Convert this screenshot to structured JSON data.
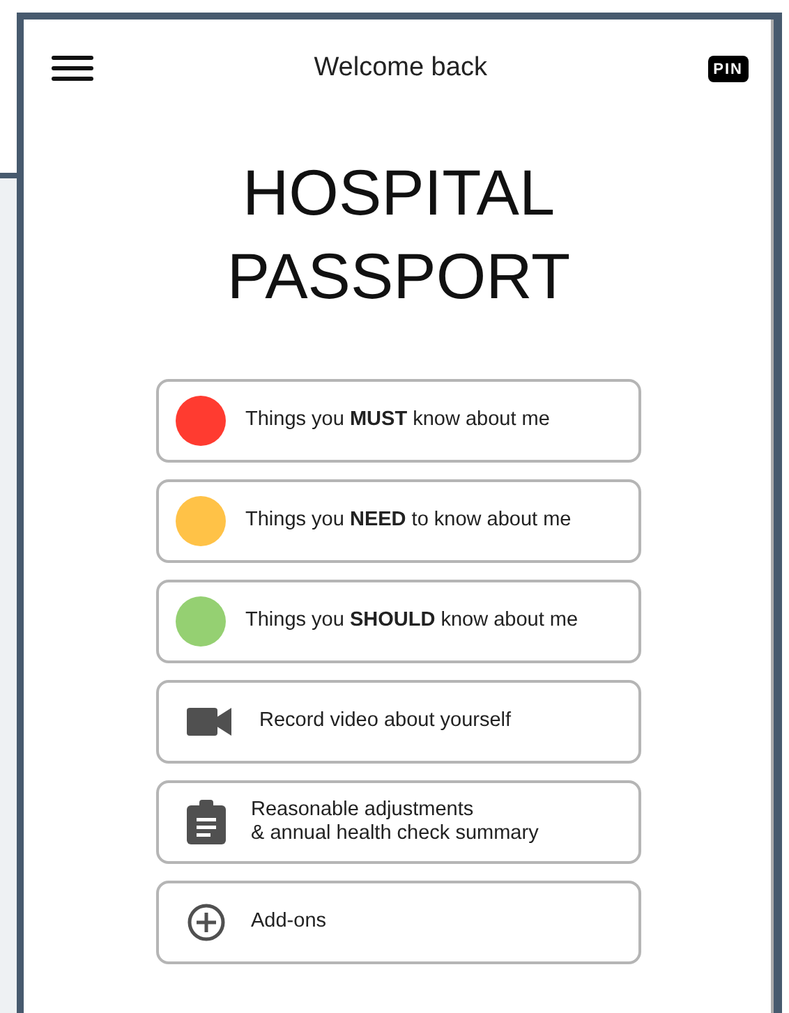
{
  "header": {
    "title": "Welcome back",
    "pin": "PIN"
  },
  "title_lines": [
    "HOSPITAL",
    "PASSPORT"
  ],
  "menu_items": [
    {
      "kind": "dot",
      "color": "#ff3b30",
      "label": "Things you **MUST** know about me"
    },
    {
      "kind": "dot",
      "color": "#ffc247",
      "label": "Things you **NEED** to know about me"
    },
    {
      "kind": "dot",
      "color": "#95d072",
      "label": "Things you **SHOULD** know about me"
    },
    {
      "kind": "video",
      "label": "Record video about yourself"
    },
    {
      "kind": "clipboard",
      "label": "Reasonable adjustments\n& annual health check summary"
    },
    {
      "kind": "add",
      "label": "Add-ons"
    }
  ]
}
